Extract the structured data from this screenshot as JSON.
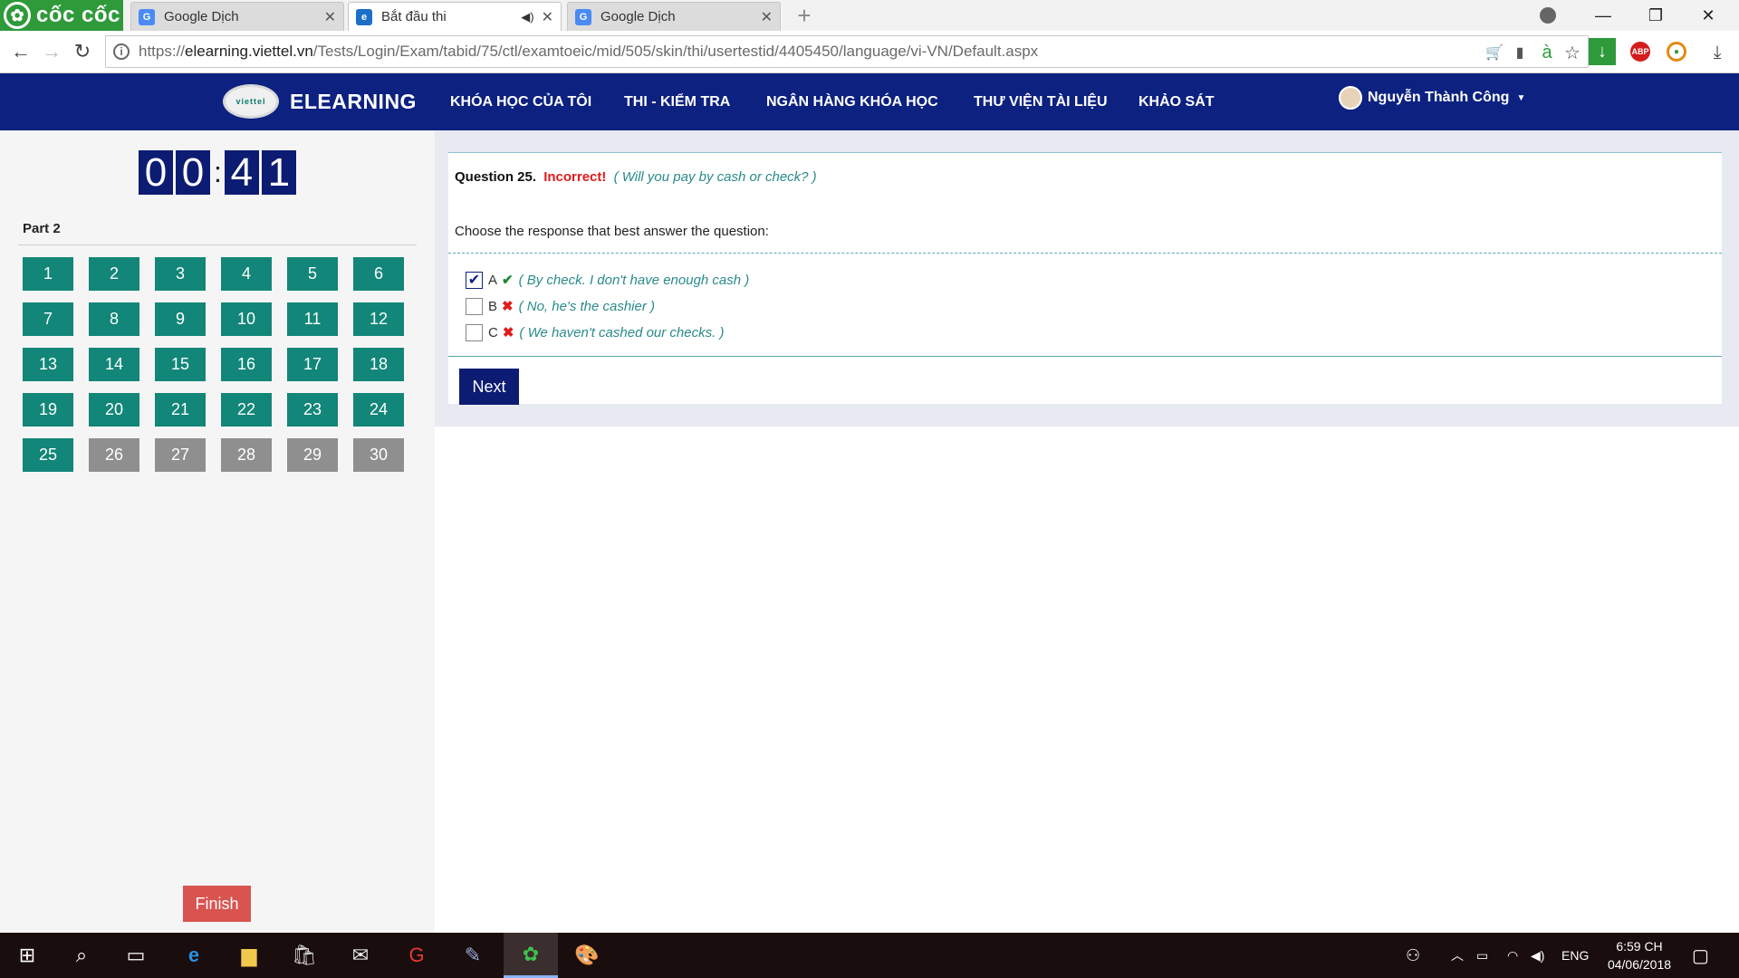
{
  "browser": {
    "brand": "cốc cốc",
    "tabs": [
      {
        "title": "Google Dịch",
        "active": false
      },
      {
        "title": "Bắt đầu thi",
        "active": true
      },
      {
        "title": "Google Dịch",
        "active": false
      }
    ],
    "url_prefix": "https://",
    "url_host": "elearning.viettel.vn",
    "url_path": "/Tests/Login/Exam/tabid/75/ctl/examtoeic/mid/505/skin/thi/usertestid/4405450/language/vi-VN/Default.aspx"
  },
  "site": {
    "logo_text": "viettel",
    "name": "ELEARNING",
    "nav": [
      "KHÓA HỌC CỦA TÔI",
      "THI - KIỂM TRA",
      "NGÂN HÀNG KHÓA HỌC",
      "THƯ VIỆN TÀI LIỆU",
      "KHẢO SÁT"
    ],
    "user_name": "Nguyễn Thành Công"
  },
  "timer": {
    "d1": "0",
    "d2": "0",
    "d3": "4",
    "d4": "1"
  },
  "sidebar": {
    "part_label": "Part 2",
    "questions": [
      {
        "n": "1",
        "done": true
      },
      {
        "n": "2",
        "done": true
      },
      {
        "n": "3",
        "done": true
      },
      {
        "n": "4",
        "done": true
      },
      {
        "n": "5",
        "done": true
      },
      {
        "n": "6",
        "done": true
      },
      {
        "n": "7",
        "done": true
      },
      {
        "n": "8",
        "done": true
      },
      {
        "n": "9",
        "done": true
      },
      {
        "n": "10",
        "done": true
      },
      {
        "n": "11",
        "done": true
      },
      {
        "n": "12",
        "done": true
      },
      {
        "n": "13",
        "done": true
      },
      {
        "n": "14",
        "done": true
      },
      {
        "n": "15",
        "done": true
      },
      {
        "n": "16",
        "done": true
      },
      {
        "n": "17",
        "done": true
      },
      {
        "n": "18",
        "done": true
      },
      {
        "n": "19",
        "done": true
      },
      {
        "n": "20",
        "done": true
      },
      {
        "n": "21",
        "done": true
      },
      {
        "n": "22",
        "done": true
      },
      {
        "n": "23",
        "done": true
      },
      {
        "n": "24",
        "done": true
      },
      {
        "n": "25",
        "done": true
      },
      {
        "n": "26",
        "done": false
      },
      {
        "n": "27",
        "done": false
      },
      {
        "n": "28",
        "done": false
      },
      {
        "n": "29",
        "done": false
      },
      {
        "n": "30",
        "done": false
      }
    ],
    "finish_label": "Finish"
  },
  "question": {
    "number": "Question 25.",
    "status": "Incorrect!",
    "translation": "( Will you pay by cash or check? )",
    "prompt": "Choose the response that best answer the question:",
    "options": [
      {
        "letter": "A",
        "text": "( By check. I don't have enough cash )",
        "checked": true,
        "correct": true
      },
      {
        "letter": "B",
        "text": "( No, he's the cashier )",
        "checked": false,
        "correct": false
      },
      {
        "letter": "C",
        "text": "( We haven't cashed our checks. )",
        "checked": false,
        "correct": false
      }
    ],
    "next_label": "Next"
  },
  "taskbar": {
    "language": "ENG",
    "time": "6:59 CH",
    "date": "04/06/2018"
  },
  "colors": {
    "nav_bg": "#0d2181",
    "done": "#128678",
    "todo": "#8f8f8f",
    "finish": "#d9534f",
    "incorrect": "#e11b1b"
  }
}
